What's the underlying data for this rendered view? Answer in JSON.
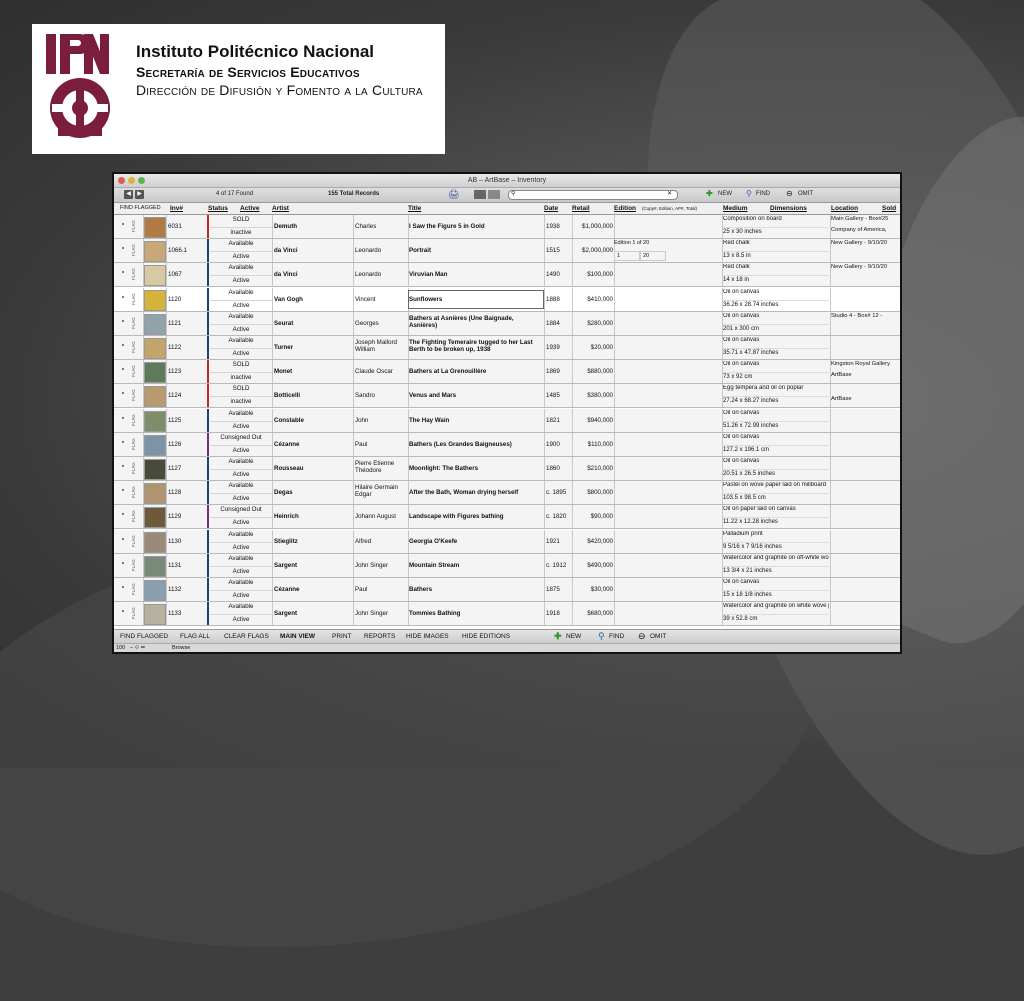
{
  "logo": {
    "line1": "Instituto Politécnico Nacional",
    "line2": "Secretaría de Servicios Educativos",
    "line3": "Dirección de Difusión y Fomento a la Cultura",
    "seal_color": "#7b1e3d"
  },
  "window": {
    "title": "AB – ArtBase – Inventory",
    "found": "4 of 17 Found",
    "total": "155 Total Records",
    "search_value": "",
    "new_label": "NEW",
    "find_label": "FIND",
    "omit_label": "OMIT"
  },
  "header": {
    "find_flagged": "FIND FLAGGED",
    "inv": "Inv#",
    "status": "Status",
    "active": "Active",
    "artist": "Artist",
    "title": "Title",
    "date": "Date",
    "retail": "Retail",
    "edition": "Edition",
    "edition_hint": "(Copy#, Edition, AP#, Total)",
    "medium": "Medium",
    "dimensions": "Dimensions",
    "location": "Location",
    "sold": "Sold"
  },
  "colors": {
    "sold": "#cc2222",
    "available": "#1f3f7a",
    "consigned": "#7a2a7a"
  },
  "rows": [
    {
      "inv": "6031",
      "status": "SOLD",
      "active": "inactive",
      "last": "Demuth",
      "first": "Charles",
      "title": "I Saw the Figure 5 in Gold",
      "date": "1938",
      "retail": "$1,000,000",
      "medium": "Composition on board",
      "dim": "25 x 30 inches",
      "loc": "Main Gallery - Box#25",
      "loc2": "Company of America,",
      "thumb": "#b07a40"
    },
    {
      "inv": "1066.1",
      "status": "Available",
      "active": "Active",
      "last": "da Vinci",
      "first": "Leonardo",
      "title": "Portrait",
      "date": "1515",
      "retail": "$2,000,000",
      "medium": "Red chalk",
      "dim": "13 x 8.5 in",
      "loc": "New Gallery - 9/10/20",
      "loc2": "",
      "edition": "Edition 1 of 20",
      "ed1": "1",
      "ed2": "20",
      "thumb": "#c9a878"
    },
    {
      "inv": "1067",
      "status": "Available",
      "active": "Active",
      "last": "da Vinci",
      "first": "Leonardo",
      "title": "Viruvian Man",
      "date": "1490",
      "retail": "$100,000",
      "medium": "Red chalk",
      "dim": "14 x 18 in",
      "loc": "New Gallery - 9/10/20",
      "loc2": "",
      "thumb": "#d8c9a4"
    },
    {
      "inv": "1120",
      "status": "Available",
      "active": "Active",
      "last": "Van Gogh",
      "first": "Vincent",
      "title": "Sunflowers",
      "date": "1888",
      "retail": "$410,000",
      "medium": "Oil on canvas",
      "dim": "36.26 x 28.74 inches",
      "loc": "",
      "loc2": "",
      "thumb": "#d4b43a"
    },
    {
      "inv": "1121",
      "status": "Available",
      "active": "Active",
      "last": "Seurat",
      "first": "Georges",
      "title": "Bathers at Asnières (Une Baignade, Asnières)",
      "date": "1884",
      "retail": "$280,000",
      "medium": "Oil on canvas",
      "dim": "201 x 300 cm",
      "loc": "Studio 4 - Box# 12 -",
      "loc2": "",
      "thumb": "#8fa3a8"
    },
    {
      "inv": "1122",
      "status": "Available",
      "active": "Active",
      "last": "Turner",
      "first": "Joseph Mallord William",
      "title": "The Fighting Temeraire tugged to her Last Berth to be broken up, 1938",
      "date": "1939",
      "retail": "$20,000",
      "medium": "Oil on canvas",
      "dim": "35.71 x 47.87 inches",
      "loc": "",
      "loc2": "",
      "thumb": "#c3a56a"
    },
    {
      "inv": "1123",
      "status": "SOLD",
      "active": "inactive",
      "last": "Monet",
      "first": "Claude Oscar",
      "title": "Bathers at La Grenouillère",
      "date": "1869",
      "retail": "$880,000",
      "medium": "Oil on canvas",
      "dim": "73 x 92 cm",
      "loc": "Kingston Royal Gallery",
      "loc2": "ArtBase",
      "thumb": "#5e7a5a"
    },
    {
      "inv": "1124",
      "status": "SOLD",
      "active": "inactive",
      "last": "Botticelli",
      "first": "Sandro",
      "title": "Venus and Mars",
      "date": "1485",
      "retail": "$380,000",
      "medium": "Egg tempera and oil on poplar",
      "dim": "27.24 x 68.27 inches",
      "loc": "",
      "loc2": "ArtBase",
      "thumb": "#b99a6e"
    },
    {
      "inv": "1125",
      "status": "Available",
      "active": "Active",
      "last": "Constable",
      "first": "John",
      "title": "The Hay Wain",
      "date": "1821",
      "retail": "$940,000",
      "medium": "Oil on canvas",
      "dim": "51.26 x 72.99 inches",
      "loc": "",
      "loc2": "",
      "thumb": "#7f8e6a"
    },
    {
      "inv": "1126",
      "status": "Consigned Out",
      "active": "Active",
      "last": "Cézanne",
      "first": "Paul",
      "title": "Bathers (Les Grandes Baigneuses)",
      "date": "1900",
      "retail": "$110,000",
      "medium": "Oil on canvas",
      "dim": "127.2 x 196.1 cm",
      "loc": "",
      "loc2": "",
      "thumb": "#7d93a8"
    },
    {
      "inv": "1127",
      "status": "Available",
      "active": "Active",
      "last": "Rousseau",
      "first": "Pierre Etienne Théodore",
      "title": "Moonlight: The Bathers",
      "date": "1860",
      "retail": "$210,000",
      "medium": "Oil on canvas",
      "dim": "20.51 x 26.5 inches",
      "loc": "",
      "loc2": "",
      "thumb": "#4a4a3a"
    },
    {
      "inv": "1128",
      "status": "Available",
      "active": "Active",
      "last": "Degas",
      "first": "Hilaire Germain Edgar",
      "title": "After the Bath, Woman drying herself",
      "date": "c. 1895",
      "retail": "$800,000",
      "medium": "Pastel on wove paper laid on millboard",
      "dim": "103.5 x 98.5 cm",
      "loc": "",
      "loc2": "",
      "thumb": "#b09470"
    },
    {
      "inv": "1129",
      "status": "Consigned Out",
      "active": "Active",
      "last": "Heinrich",
      "first": "Johann August",
      "title": "Landscape with Figures bathing",
      "date": "c. 1820",
      "retail": "$90,000",
      "medium": "Oil on paper laid on canvas",
      "dim": "11.22 x 12.28 inches",
      "loc": "",
      "loc2": "",
      "thumb": "#6e5a3a"
    },
    {
      "inv": "1130",
      "status": "Available",
      "active": "Active",
      "last": "Stieglitz",
      "first": "Alfred",
      "title": "Georgia O'Keefe",
      "date": "1921",
      "retail": "$420,000",
      "medium": "Palladium print",
      "dim": "9 5/16 x 7 9/16 inches",
      "loc": "",
      "loc2": "",
      "thumb": "#9a8a78"
    },
    {
      "inv": "1131",
      "status": "Available",
      "active": "Active",
      "last": "Sargent",
      "first": "John Singer",
      "title": "Mountain Stream",
      "date": "c. 1912",
      "retail": "$490,000",
      "medium": "Watercolor and graphite on off-white wove paper",
      "dim": "13 3/4 x 21 inches",
      "loc": "",
      "loc2": "",
      "thumb": "#7a8a7a"
    },
    {
      "inv": "1132",
      "status": "Available",
      "active": "Active",
      "last": "Cézanne",
      "first": "Paul",
      "title": "Bathers",
      "date": "1875",
      "retail": "$30,000",
      "medium": "Oil on canvas",
      "dim": "15 x 18 1/8 inches",
      "loc": "",
      "loc2": "",
      "thumb": "#8aa0b0"
    },
    {
      "inv": "1133",
      "status": "Available",
      "active": "Active",
      "last": "Sargent",
      "first": "John Singer",
      "title": "Tommies Bathing",
      "date": "1918",
      "retail": "$680,000",
      "medium": "Watercolor and graphite on white wove paper",
      "dim": "39 x 52.8 cm",
      "loc": "",
      "loc2": "",
      "thumb": "#b8b0a0"
    }
  ],
  "toolbar": {
    "find_flagged": "FIND FLAGGED",
    "flag_all": "FLAG ALL",
    "clear_flags": "CLEAR FLAGS",
    "main_view": "MAIN VIEW",
    "print": "PRINT",
    "reports": "REPORTS",
    "hide_images": "HIDE IMAGES",
    "hide_editions": "HIDE EDITIONS",
    "new": "NEW",
    "find": "FIND",
    "omit": "OMIT"
  },
  "bottombar": {
    "zoom": "100",
    "mode": "Browse"
  }
}
